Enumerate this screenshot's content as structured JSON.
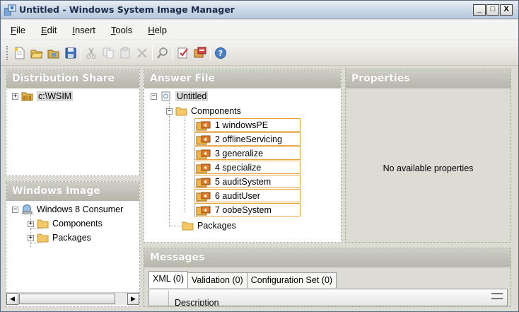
{
  "window": {
    "title": "Untitled - Windows System Image Manager",
    "controls": {
      "minimize": "_",
      "maximize": "□",
      "close": "X"
    }
  },
  "menu": [
    {
      "label": "File",
      "accel": "F",
      "rest": "ile"
    },
    {
      "label": "Edit",
      "accel": "E",
      "rest": "dit"
    },
    {
      "label": "Insert",
      "accel": "I",
      "rest": "nsert"
    },
    {
      "label": "Tools",
      "accel": "T",
      "rest": "ools"
    },
    {
      "label": "Help",
      "accel": "H",
      "rest": "elp"
    }
  ],
  "toolbar": {
    "icons": [
      "new-answer-file-icon",
      "open-answer-file-icon",
      "open-distribution-share-icon",
      "save-icon",
      "cut-icon",
      "copy-icon",
      "paste-icon",
      "delete-icon",
      "find-icon",
      "validate-icon",
      "create-configuration-set-icon",
      "help-icon"
    ]
  },
  "distribution_share": {
    "header": "Distribution Share",
    "root": "c:\\WSIM"
  },
  "windows_image": {
    "header": "Windows Image",
    "root": "Windows 8 Consumer",
    "children": [
      "Components",
      "Packages"
    ]
  },
  "answer_file": {
    "header": "Answer File",
    "root": "Untitled",
    "components": "Components",
    "passes": [
      "1 windowsPE",
      "2 offlineServicing",
      "3 generalize",
      "4 specialize",
      "5 auditSystem",
      "6 auditUser",
      "7 oobeSystem"
    ],
    "packages": "Packages"
  },
  "properties": {
    "header": "Properties",
    "empty_text": "No available properties"
  },
  "messages": {
    "header": "Messages",
    "tabs": [
      "XML (0)",
      "Validation (0)",
      "Configuration Set (0)"
    ],
    "column": "Description"
  },
  "colors": {
    "pass_border": "#e8a33c",
    "panel_header": "#b7b6ad",
    "title_text": "#1c2c4a"
  }
}
